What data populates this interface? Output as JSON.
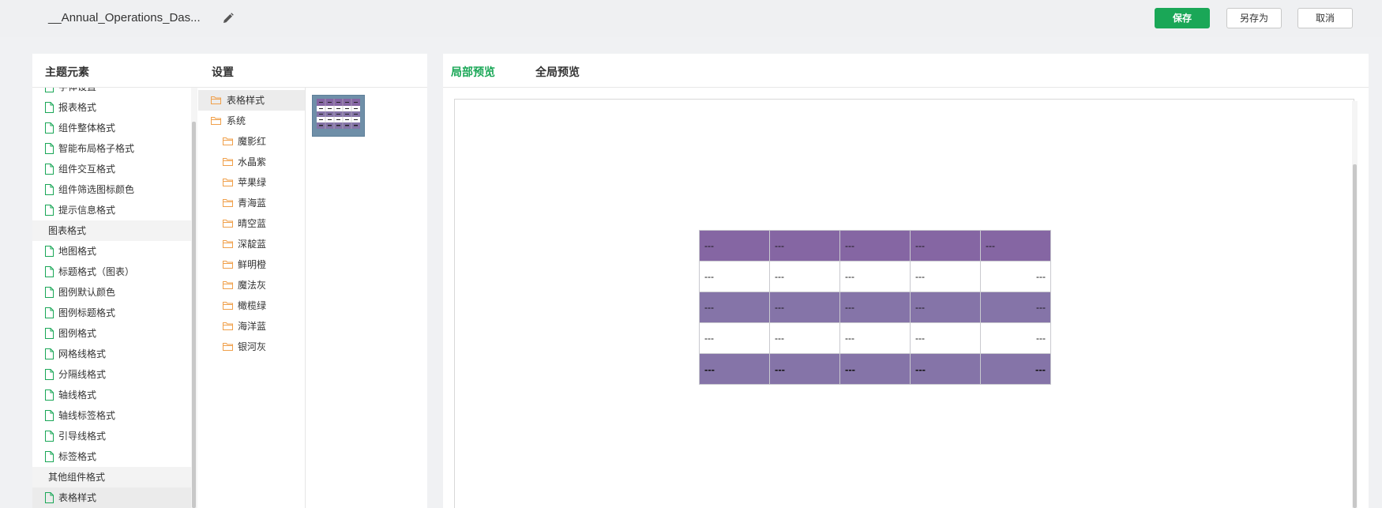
{
  "header": {
    "title": "__Annual_Operations_Das...",
    "save_label": "保存",
    "save_as_label": "另存为",
    "cancel_label": "取消"
  },
  "left_panel": {
    "theme_elements_title": "主题元素",
    "settings_title": "设置",
    "theme_items": [
      {
        "label": "字体设置",
        "type": "leaf"
      },
      {
        "label": "报表格式",
        "type": "leaf"
      },
      {
        "label": "组件整体格式",
        "type": "leaf"
      },
      {
        "label": "智能布局格子格式",
        "type": "leaf"
      },
      {
        "label": "组件交互格式",
        "type": "leaf"
      },
      {
        "label": "组件筛选图标颜色",
        "type": "leaf"
      },
      {
        "label": "提示信息格式",
        "type": "leaf"
      },
      {
        "label": "图表格式",
        "type": "group"
      },
      {
        "label": "地图格式",
        "type": "leaf"
      },
      {
        "label": "标题格式（图表）",
        "type": "leaf"
      },
      {
        "label": "图例默认颜色",
        "type": "leaf"
      },
      {
        "label": "图例标题格式",
        "type": "leaf"
      },
      {
        "label": "图例格式",
        "type": "leaf"
      },
      {
        "label": "网格线格式",
        "type": "leaf"
      },
      {
        "label": "分隔线格式",
        "type": "leaf"
      },
      {
        "label": "轴线格式",
        "type": "leaf"
      },
      {
        "label": "轴线标签格式",
        "type": "leaf"
      },
      {
        "label": "引导线格式",
        "type": "leaf"
      },
      {
        "label": "标签格式",
        "type": "leaf"
      },
      {
        "label": "其他组件格式",
        "type": "group"
      },
      {
        "label": "表格样式",
        "type": "leaf",
        "selected": true
      }
    ],
    "folders": {
      "root": "表格样式",
      "system": "系统",
      "items": [
        "魔影红",
        "水晶紫",
        "苹果绿",
        "青海蓝",
        "晴空蓝",
        "深靛蓝",
        "鲜明橙",
        "魔法灰",
        "橄榄绿",
        "海洋蓝",
        "银河灰"
      ]
    },
    "icons": {
      "leaf": "document-icon",
      "folder": "folder-icon",
      "edit": "pencil-icon"
    }
  },
  "right_panel": {
    "tabs": [
      {
        "label": "局部预览",
        "active": true
      },
      {
        "label": "全局预览",
        "active": false
      }
    ],
    "preview_table": {
      "rows": [
        [
          "---",
          "---",
          "---",
          "---",
          "---"
        ],
        [
          "---",
          "---",
          "---",
          "---",
          "---"
        ],
        [
          "---",
          "---",
          "---",
          "---",
          "---"
        ],
        [
          "---",
          "---",
          "---",
          "---",
          "---"
        ],
        [
          "---",
          "---",
          "---",
          "---",
          "---"
        ]
      ]
    }
  },
  "colors": {
    "accent": "#1aa757",
    "header_row": "#8566a3",
    "band_row": "#8574a8",
    "thumbnail": "#6f8fa8"
  }
}
